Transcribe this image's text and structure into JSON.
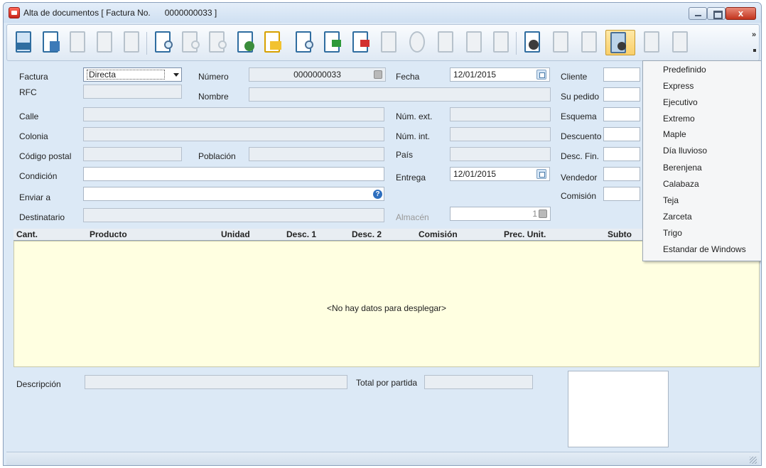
{
  "window": {
    "title": "Alta de documentos [ Factura No.      0000000033 ]",
    "close_glyph": "x"
  },
  "form": {
    "factura_label": "Factura",
    "factura_value": "Directa",
    "numero_label": "Número",
    "numero_value": "0000000033",
    "fecha_label": "Fecha",
    "fecha_value": "12/01/2015",
    "cliente_label": "Cliente",
    "rfc_label": "RFC",
    "nombre_label": "Nombre",
    "su_pedido_label": "Su pedido",
    "calle_label": "Calle",
    "num_ext_label": "Núm. ext.",
    "esquema_label": "Esquema",
    "colonia_label": "Colonia",
    "num_int_label": "Núm. int.",
    "descuento_label": "Descuento",
    "codigo_postal_label": "Código postal",
    "poblacion_label": "Población",
    "pais_label": "País",
    "desc_fin_label": "Desc. Fin.",
    "condicion_label": "Condición",
    "entrega_label": "Entrega",
    "entrega_value": "12/01/2015",
    "vendedor_label": "Vendedor",
    "enviar_a_label": "Enviar a",
    "comision_label": "Comisión",
    "destinatario_label": "Destinatario",
    "almacen_label": "Almacén",
    "almacen_value": "1",
    "help_glyph": "?"
  },
  "grid": {
    "columns": [
      "Cant.",
      "Producto",
      "Unidad",
      "Desc. 1",
      "Desc. 2",
      "Comisión",
      "Prec. Unit.",
      "Subto"
    ],
    "empty_message": "<No hay datos para desplegar>"
  },
  "footer": {
    "descripcion_label": "Descripción",
    "total_label": "Total por partida"
  },
  "toolbar": {
    "overflow_glyph": "»"
  },
  "theme_menu": {
    "items": [
      "Predefinido",
      "Express",
      "Ejecutivo",
      "Extremo",
      "Maple",
      "Día lluvioso",
      "Berenjena",
      "Calabaza",
      "Teja",
      "Zarceta",
      "Trigo",
      "Estandar de Windows"
    ]
  },
  "colors": {
    "window_bg": "#dce9f6",
    "grid_body": "#ffffe1",
    "selected_tool": "#f9cf6a"
  }
}
